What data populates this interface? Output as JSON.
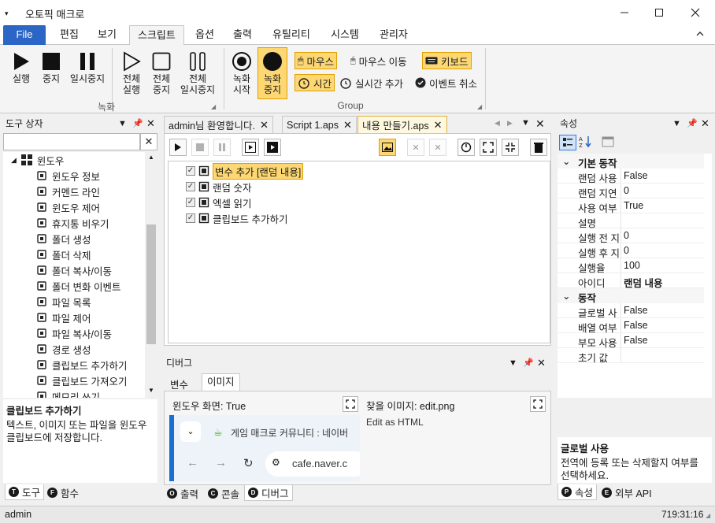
{
  "app": {
    "title": "오토픽 매크로"
  },
  "menu_tabs": [
    "File",
    "편집",
    "보기",
    "스크립트",
    "옵션",
    "출력",
    "유틸리티",
    "시스템",
    "관리자"
  ],
  "ribbon": {
    "record_group_label": "녹화",
    "group_label": "Group",
    "buttons": {
      "play": "실행",
      "stop": "중지",
      "pause": "일시중지",
      "play_all": "전체\n실행",
      "stop_all": "전체\n중지",
      "pause_all": "전체\n일시중지",
      "record_start": "녹화\n시작",
      "record_stop": "녹화\n중지"
    },
    "options": {
      "mouse": "마우스",
      "mouse_move": "마우스 이동",
      "keyboard": "키보드",
      "time": "시간",
      "realtime_add": "실시간 추가",
      "event_cancel": "이벤트 취소"
    }
  },
  "toolbox": {
    "title": "도구 상자",
    "category": "윈도우",
    "items": [
      "윈도우 정보",
      "커멘드 라인",
      "윈도우 제어",
      "휴지통 비우기",
      "폴더 생성",
      "폴더 삭제",
      "폴더 복사/이동",
      "폴더 변화 이벤트",
      "파일 목록",
      "파일 제어",
      "파일 복사/이동",
      "경로 생성",
      "클립보드 추가하기",
      "클립보드 가져오기",
      "메모리 쓰기"
    ],
    "desc_title": "클립보드 추가하기",
    "desc_text": "텍스트, 이미지 또는 파일을 윈도우 클립보드에 저장합니다.",
    "tabs": [
      "도구",
      "함수"
    ],
    "tab_icons": [
      "T",
      "F"
    ]
  },
  "documents": {
    "tabs": [
      "admin님 환영합니다.",
      "Script 1.aps",
      "내용 만들기.aps"
    ],
    "rows": [
      {
        "label": "변수 추가 [랜덤 내용]",
        "checked": true
      },
      {
        "label": "랜덤 숫자",
        "checked": true
      },
      {
        "label": "엑셀 읽기",
        "checked": true
      },
      {
        "label": "클립보드 추가하기",
        "checked": true
      }
    ]
  },
  "debug": {
    "title": "디버그",
    "tabs": [
      "변수",
      "이미지"
    ],
    "window_label": "윈도우 화면: True",
    "find_label": "찾을 이미지: edit.png",
    "edit_as_html": "Edit as HTML",
    "browser_tab_title": "게임 매크로 커뮤니티 : 네이버",
    "browser_url": "cafe.naver.c",
    "bottom_tabs": [
      "출력",
      "콘솔",
      "디버그"
    ],
    "bottom_tab_icons": [
      "O",
      "C",
      "D"
    ]
  },
  "properties": {
    "title": "속성",
    "categories": [
      {
        "name": "기본 동작",
        "rows": [
          {
            "key": "랜덤 사용",
            "value": "False"
          },
          {
            "key": "랜덤 지연",
            "value": "0"
          },
          {
            "key": "사용 여부",
            "value": "True"
          },
          {
            "key": "설명",
            "value": ""
          },
          {
            "key": "실행 전 지",
            "value": "0"
          },
          {
            "key": "실행 후 지",
            "value": "0"
          },
          {
            "key": "실행율",
            "value": "100"
          },
          {
            "key": "아이디",
            "value": "랜덤 내용"
          }
        ]
      },
      {
        "name": "동작",
        "rows": [
          {
            "key": "글로벌 사",
            "value": "False"
          },
          {
            "key": "배열 여부",
            "value": "False"
          },
          {
            "key": "부모 사용",
            "value": "False"
          },
          {
            "key": "초기 값",
            "value": ""
          }
        ]
      }
    ],
    "desc_title": "글로벌 사용",
    "desc_text": "전역에 등록 또는 삭제할지 여부를 선택하세요.",
    "bottom_tabs": [
      "속성",
      "외부 API"
    ],
    "bottom_tab_icons": [
      "P",
      "E"
    ]
  },
  "status": {
    "user": "admin",
    "time": "719:31:16"
  },
  "colors": {
    "accent": "#2b65c6",
    "highlight": "#fcd773",
    "highlight_border": "#e0a100"
  }
}
